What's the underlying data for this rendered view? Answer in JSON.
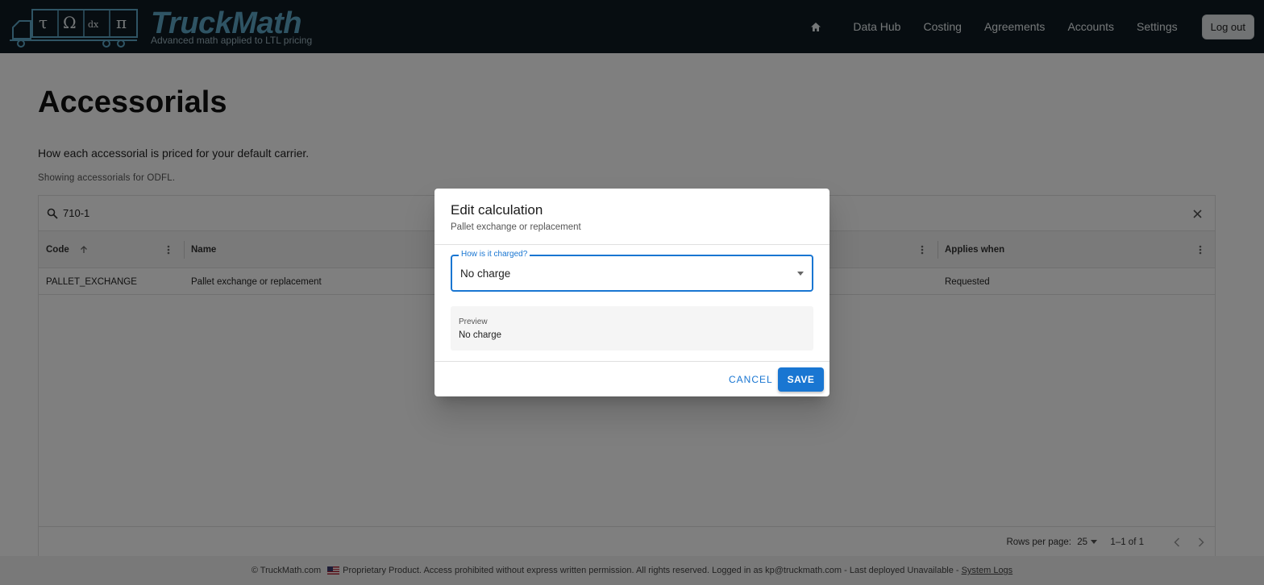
{
  "header": {
    "logo_title": "TruckMath",
    "logo_subtitle": "Advanced math applied to LTL pricing",
    "logo_symbols": [
      "τ",
      "Ω",
      "dx",
      "π"
    ],
    "nav": [
      "Data Hub",
      "Costing",
      "Agreements",
      "Accounts",
      "Settings"
    ],
    "logout_label": "Log out"
  },
  "page": {
    "title": "Accessorials",
    "description": "How each accessorial is priced for your default carrier.",
    "note": "Showing accessorials for ODFL."
  },
  "grid": {
    "search_value": "710-1",
    "columns": [
      "Code",
      "Name",
      "Applies when"
    ],
    "rows": [
      {
        "code": "PALLET_EXCHANGE",
        "name": "Pallet exchange or replacement",
        "applies_when": "Requested"
      }
    ],
    "footer": {
      "rows_per_page_label": "Rows per page:",
      "rows_per_page_value": "25",
      "range": "1–1 of 1"
    }
  },
  "footer": {
    "copyright": "© TruckMath.com",
    "notice": "Proprietary Product. Access prohibited without express written permission. All rights reserved. Logged in as kp@truckmath.com - Last deployed Unavailable -",
    "link": "System Logs"
  },
  "dialog": {
    "title": "Edit calculation",
    "subtitle": "Pallet exchange or replacement",
    "field_label": "How is it charged?",
    "field_value": "No charge",
    "preview_label": "Preview",
    "preview_value": "No charge",
    "cancel_label": "CANCEL",
    "save_label": "SAVE"
  },
  "colors": {
    "header_bg": "#0e1b22",
    "brand": "#5fa8c9",
    "accent": "#1976d2"
  }
}
